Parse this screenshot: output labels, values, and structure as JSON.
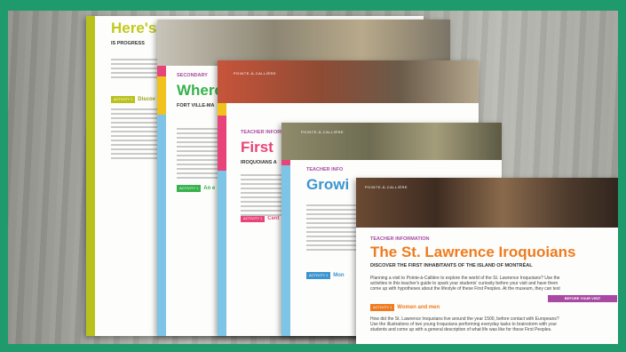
{
  "sheets": [
    {
      "title": "Here's",
      "subtitle": "IS PROGRESS",
      "activity_badge": "ACTIVITY 1",
      "activity": "Discov"
    },
    {
      "label": "SECONDARY",
      "title": "Where",
      "subtitle": "FORT VILLE-MA",
      "activity_badge": "ACTIVITY 1",
      "activity": "An e"
    },
    {
      "logo": "POINTE-À-CALLIÈRE",
      "label": "TEACHER INFORMATION",
      "title": "First",
      "subtitle": "IROQUOIANS A",
      "activity_badge": "ACTIVITY 1",
      "activity": "Cent"
    },
    {
      "logo": "POINTE-À-CALLIÈRE",
      "label": "TEACHER INFO",
      "title": "Growi",
      "activity_badge": "ACTIVITY 1",
      "activity": "Mon"
    },
    {
      "logo": "POINTE-À-CALLIÈRE",
      "label": "TEACHER INFORMATION",
      "title": "The St. Lawrence Iroquoians",
      "subtitle": "DISCOVER THE FIRST INHABITANTS OF THE ISLAND OF MONTRÉAL",
      "intro": [
        "Planning a visit to Pointe-à-Callière to explore the world of the St. Lawrence Iroquoians? Use the",
        "activities in this teacher's guide to spark your students' curiosity before your visit and have them",
        "come up with hypotheses about the lifestyle of these First Peoples. At the museum, they can test"
      ],
      "tab": "BEFORE YOUR VISIT",
      "activity_badge": "ACTIVITY 1",
      "activity": "Women and men",
      "body": [
        "How did the St. Lawrence Iroquoians live around the year 1500, before contact with Europeans?",
        "Use the illustrations of two young Iroquoians performing everyday tasks to brainstorm with your",
        "students and come up with a general description of what life was like for these First Peoples."
      ]
    }
  ]
}
